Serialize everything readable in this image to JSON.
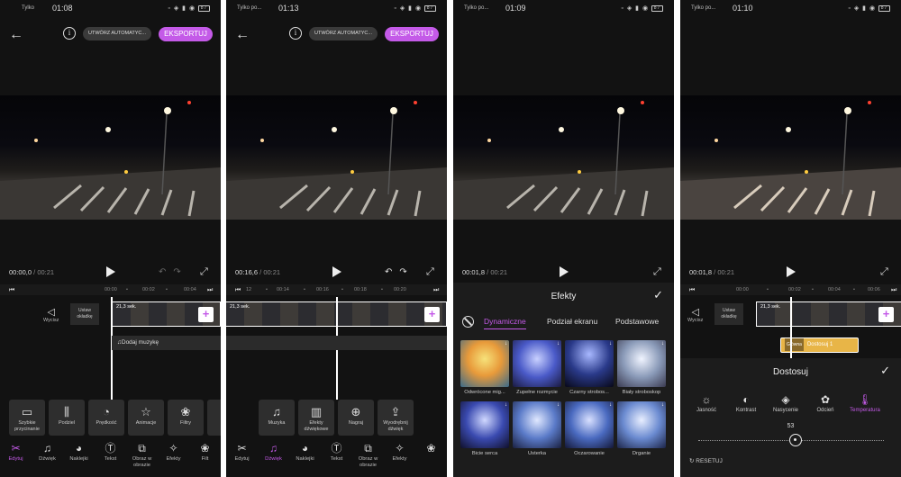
{
  "screens": [
    {
      "status": {
        "carrier": "Tylko",
        "time": "01:08",
        "battery": "87"
      },
      "header": {
        "auto_label": "UTWÓRZ AUTOMATYC...",
        "export_label": "EKSPORTUJ"
      },
      "playback": {
        "current": "00:00,0",
        "separator": "/",
        "total": "00:21"
      },
      "ruler": [
        "00:00",
        "•",
        "00:02",
        "•",
        "00:04"
      ],
      "timeline": {
        "mute_label": "Wycisz",
        "cover_label": "Ustaw okładkę",
        "clip_duration": "21,3 sek.",
        "music_label": "Dodaj muzykę"
      },
      "tools": [
        {
          "icon": "quick-trim-icon",
          "label": "Szybkie przycinanie"
        },
        {
          "icon": "split-icon",
          "label": "Podziel"
        },
        {
          "icon": "speed-icon",
          "label": "Prędkość"
        },
        {
          "icon": "animation-icon",
          "label": "Animacje"
        },
        {
          "icon": "filters-icon",
          "label": "Filtry"
        },
        {
          "icon": "more-icon",
          "label": "Us"
        }
      ],
      "bottom_nav": [
        {
          "icon": "scissors-icon",
          "label": "Edytuj",
          "active": true
        },
        {
          "icon": "music-note-icon",
          "label": "Dźwięk",
          "active": false
        },
        {
          "icon": "sticker-icon",
          "label": "Naklejki",
          "active": false
        },
        {
          "icon": "text-icon",
          "label": "Tekst",
          "active": false
        },
        {
          "icon": "picture-in-picture-icon",
          "label": "Obraz w obrazie",
          "active": false
        },
        {
          "icon": "effects-icon",
          "label": "Efekty",
          "active": false
        },
        {
          "icon": "filter-icon",
          "label": "Filt",
          "active": false
        }
      ]
    },
    {
      "status": {
        "carrier": "Tylko po...",
        "time": "01:13",
        "battery": "87"
      },
      "header": {
        "auto_label": "UTWÓRZ AUTOMATYC...",
        "export_label": "EKSPORTUJ"
      },
      "playback": {
        "current": "00:16,6",
        "separator": "/",
        "total": "00:21"
      },
      "ruler": [
        "12",
        "•",
        "00:14",
        "•",
        "00:16",
        "•",
        "00:18",
        "•",
        "00:20"
      ],
      "timeline": {
        "clip_duration": "21,3 sek."
      },
      "tools": [
        {
          "icon": "music-icon",
          "label": "Muzyka"
        },
        {
          "icon": "sound-effects-icon",
          "label": "Efekty dźwiękowe"
        },
        {
          "icon": "microphone-icon",
          "label": "Nagraj"
        },
        {
          "icon": "extract-audio-icon",
          "label": "Wyodrębnij dźwięk"
        }
      ],
      "bottom_nav": [
        {
          "icon": "scissors-icon",
          "label": "Edytuj",
          "active": false
        },
        {
          "icon": "music-note-icon",
          "label": "Dźwięk",
          "active": true
        },
        {
          "icon": "sticker-icon",
          "label": "Naklejki",
          "active": false
        },
        {
          "icon": "text-icon",
          "label": "Tekst",
          "active": false
        },
        {
          "icon": "picture-in-picture-icon",
          "label": "Obraz w obrazie",
          "active": false
        },
        {
          "icon": "effects-icon",
          "label": "Efekty",
          "active": false
        },
        {
          "icon": "filter-icon",
          "label": "",
          "active": false
        }
      ]
    },
    {
      "status": {
        "carrier": "Tylko po...",
        "time": "01:09",
        "battery": "87"
      },
      "playback": {
        "current": "00:01,8",
        "separator": "/",
        "total": "00:21"
      },
      "effects": {
        "title": "Efekty",
        "tabs": [
          {
            "label": "Dynamiczne",
            "active": true
          },
          {
            "label": "Podział ekranu",
            "active": false
          },
          {
            "label": "Podstawowe",
            "active": false
          }
        ],
        "items": [
          {
            "label": "Odwrócone mig...",
            "color": "#e89a3a"
          },
          {
            "label": "Zupełne rozmycie",
            "color": "#4a5ac8"
          },
          {
            "label": "Czarny strobos...",
            "color": "#2a3a8a"
          },
          {
            "label": "Biały stroboskop",
            "color": "#8a9ab8"
          },
          {
            "label": "Bicie serca",
            "color": "#3a4ab0"
          },
          {
            "label": "Usterka",
            "color": "#5a7ac8"
          },
          {
            "label": "Oczarowanie",
            "color": "#4a6ac0"
          },
          {
            "label": "Drganie",
            "color": "#6a8ad0"
          }
        ]
      }
    },
    {
      "status": {
        "carrier": "Tylko po...",
        "time": "01:10",
        "battery": "87"
      },
      "playback": {
        "current": "00:01,8",
        "separator": "/",
        "total": "00:21"
      },
      "ruler": [
        "00:00",
        "•",
        "00:02",
        "•",
        "00:04",
        "•",
        "00:06"
      ],
      "timeline": {
        "mute_label": "Wycisz",
        "cover_label": "Ustaw okładkę",
        "clip_duration": "21,3 sek.",
        "chip_tag": "Główna",
        "chip_name": "Dostosuj 1"
      },
      "adjust": {
        "title": "Dostosuj",
        "tools": [
          {
            "icon": "brightness-icon",
            "label": "Jasność",
            "active": false
          },
          {
            "icon": "contrast-icon",
            "label": "Kontrast",
            "active": false
          },
          {
            "icon": "saturation-icon",
            "label": "Nasycenie",
            "active": false
          },
          {
            "icon": "hue-icon",
            "label": "Odcień",
            "active": false
          },
          {
            "icon": "thermometer-icon",
            "label": "Temperatura",
            "active": true
          }
        ],
        "value": "53",
        "reset_label": "RESETUJ"
      }
    }
  ]
}
